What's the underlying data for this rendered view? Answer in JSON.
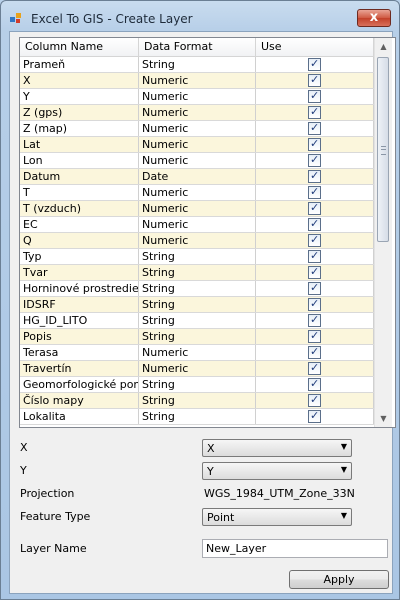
{
  "window": {
    "title": "Excel To GIS - Create Layer",
    "close_glyph": "x"
  },
  "grid": {
    "headers": [
      "Column Name",
      "Data Format",
      "Use"
    ],
    "rows": [
      {
        "name": "Prameň",
        "format": "String",
        "use": true
      },
      {
        "name": "X",
        "format": "Numeric",
        "use": true
      },
      {
        "name": "Y",
        "format": "Numeric",
        "use": true
      },
      {
        "name": "Z (gps)",
        "format": "Numeric",
        "use": true
      },
      {
        "name": "Z (map)",
        "format": "Numeric",
        "use": true
      },
      {
        "name": " Lat",
        "format": "Numeric",
        "use": true
      },
      {
        "name": " Lon",
        "format": "Numeric",
        "use": true
      },
      {
        "name": " Datum",
        "format": "Date",
        "use": true
      },
      {
        "name": " T",
        "format": "Numeric",
        "use": true
      },
      {
        "name": "T (vzduch)",
        "format": "Numeric",
        "use": true
      },
      {
        "name": "EC",
        "format": "Numeric",
        "use": true
      },
      {
        "name": "Q",
        "format": "Numeric",
        "use": true
      },
      {
        "name": "Typ",
        "format": "String",
        "use": true
      },
      {
        "name": "Tvar",
        "format": "String",
        "use": true
      },
      {
        "name": "Horninové prostredie",
        "format": "String",
        "use": true
      },
      {
        "name": "IDSRF",
        "format": "String",
        "use": true
      },
      {
        "name": "HG_ID_LITO",
        "format": "String",
        "use": true
      },
      {
        "name": "Popis",
        "format": "String",
        "use": true
      },
      {
        "name": "Terasa",
        "format": "Numeric",
        "use": true
      },
      {
        "name": "Travertín",
        "format": "Numeric",
        "use": true
      },
      {
        "name": "Geomorfologické pomery",
        "format": "String",
        "use": true
      },
      {
        "name": "Číslo mapy",
        "format": "String",
        "use": true
      },
      {
        "name": "Lokalita",
        "format": "String",
        "use": true
      }
    ],
    "scroll_up_glyph": "▲",
    "scroll_down_glyph": "▼"
  },
  "form": {
    "x_label": "X",
    "x_value": "X",
    "y_label": "Y",
    "y_value": "Y",
    "projection_label": "Projection",
    "projection_value": "WGS_1984_UTM_Zone_33N",
    "feature_type_label": "Feature Type",
    "feature_type_value": "Point",
    "layer_name_label": "Layer Name",
    "layer_name_value": "New_Layer",
    "dropdown_glyph": "▼",
    "apply_label": "Apply"
  },
  "colors": {
    "alt_row": "#fbf6dc",
    "close_button": "#c2412a"
  }
}
